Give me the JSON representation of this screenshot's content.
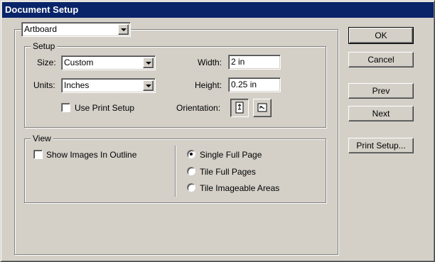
{
  "window": {
    "title": "Document Setup"
  },
  "top_select": {
    "value": "Artboard"
  },
  "setup": {
    "group_label": "Setup",
    "size_label": "Size:",
    "size_value": "Custom",
    "units_label": "Units:",
    "units_value": "Inches",
    "width_label": "Width:",
    "width_value": "2 in",
    "height_label": "Height:",
    "height_value": "0.25 in",
    "use_print_setup_label": "Use Print Setup",
    "use_print_setup_checked": false,
    "orientation_label": "Orientation:",
    "orientation_selected": "portrait"
  },
  "view": {
    "group_label": "View",
    "show_images_label": "Show Images In Outline",
    "show_images_checked": false,
    "options": [
      {
        "label": "Single Full Page",
        "checked": true
      },
      {
        "label": "Tile Full Pages",
        "checked": false
      },
      {
        "label": "Tile Imageable Areas",
        "checked": false
      }
    ]
  },
  "buttons": {
    "ok": "OK",
    "cancel": "Cancel",
    "prev": "Prev",
    "next": "Next",
    "print_setup": "Print Setup..."
  }
}
